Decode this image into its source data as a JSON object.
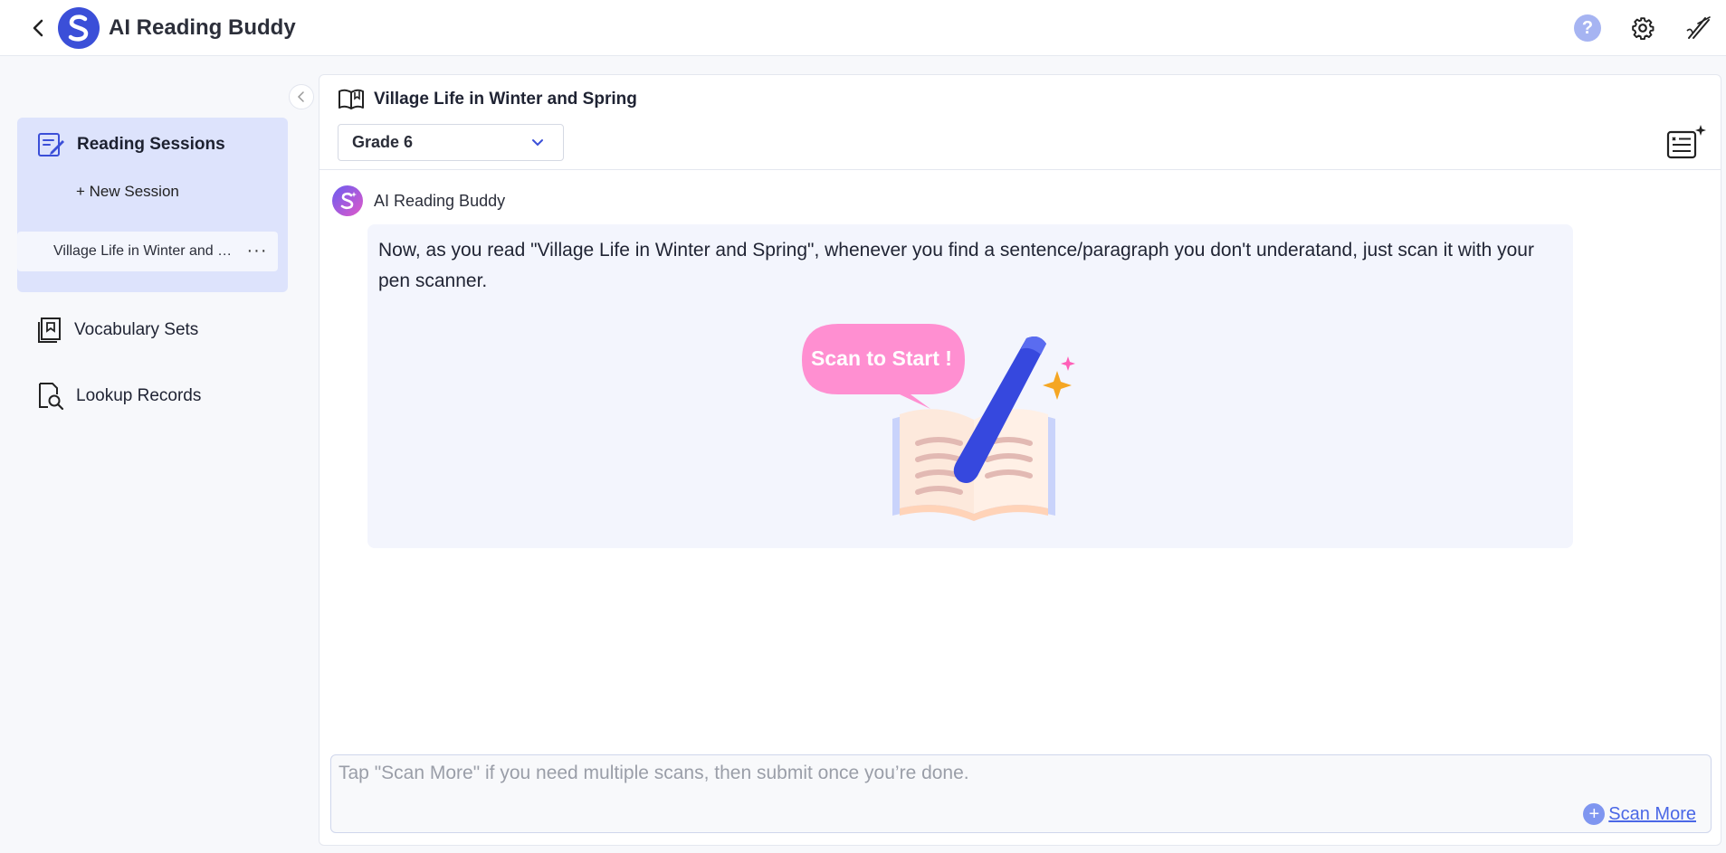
{
  "header": {
    "title": "AI Reading Buddy",
    "help_label": "?"
  },
  "sidebar": {
    "sessions_title": "Reading Sessions",
    "new_session_label": "+ New Session",
    "sessions": [
      {
        "label": "Village Life in Winter and Spring",
        "more": "···"
      }
    ],
    "nav": [
      {
        "label": "Vocabulary Sets",
        "icon": "vocabulary-book-icon"
      },
      {
        "label": "Lookup Records",
        "icon": "document-search-icon"
      }
    ]
  },
  "main": {
    "book_title": "Village Life in Winter and Spring",
    "grade_value": "Grade 6",
    "bot_name": "AI Reading Buddy",
    "message": "Now, as you read \"Village Life in Winter and Spring\", whenever you find a sentence/paragraph you don't underatand, just scan it with your pen scanner.",
    "illustration_caption": "Scan to Start !",
    "input_placeholder": "Tap \"Scan More\" if you need multiple scans, then submit once you’re done.",
    "scan_more_label": "Scan More"
  },
  "colors": {
    "accent": "#3b4fd8",
    "sidebar_active": "#dde3fc",
    "bubble": "#f3f5fd",
    "link": "#4a67e6",
    "speech_bubble": "#ff8fd1"
  }
}
